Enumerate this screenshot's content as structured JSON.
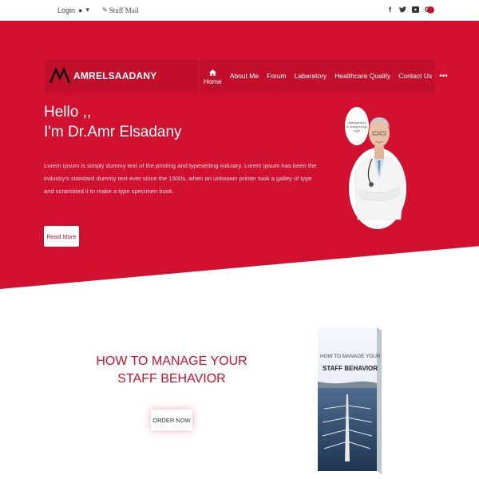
{
  "topbar": {
    "login": "Login",
    "user_caret": "▾",
    "stuff_mail": "Stuff Mail",
    "social": [
      "f",
      "t",
      "yt",
      "G+"
    ],
    "accent": "#c8102e"
  },
  "brand": {
    "name_part1": "AMR",
    "name_part2": "ELSAADANY",
    "color": "#d1112f"
  },
  "nav": {
    "items": [
      "Home",
      "About Me",
      "Forum",
      "Labaratory",
      "Healthcare Quality",
      "Contact Us"
    ],
    "more": "•••"
  },
  "hero": {
    "greeting": "Hello ,,",
    "name": "I'm Dr.Amr Elsadany",
    "body": "Lorem Ipsum is simply dummy text of the printing and typesetting industry. Lorem Ipsum has been the industry's standard dummy text ever since the 1500s, when an unknown printer took a galley of type and scrambled it to make a type specimen book.",
    "cta": "Read More",
    "bubble": "Management is doing things right"
  },
  "book": {
    "title": "HOW TO MANAGE YOUR STAFF BEHAVIOR",
    "cta": "ORDER NOW",
    "cover_line1": "HOW TO MANAGE YOUR",
    "cover_line2": "STAFF BEHAVIOR"
  }
}
